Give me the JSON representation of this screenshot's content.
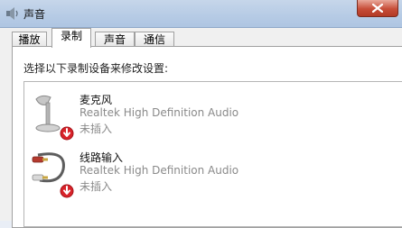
{
  "window": {
    "title": "声音",
    "icon": "speaker-icon",
    "close_icon": "close-icon"
  },
  "tabs": [
    {
      "label": "播放",
      "active": false
    },
    {
      "label": "录制",
      "active": true
    },
    {
      "label": "声音",
      "active": false
    },
    {
      "label": "通信",
      "active": false
    }
  ],
  "instruction": "选择以下录制设备来修改设置:",
  "devices": [
    {
      "name": "麦克风",
      "description": "Realtek High Definition Audio",
      "status": "未插入",
      "icon": "microphone-icon",
      "badge_icon": "unplugged-down-arrow-icon"
    },
    {
      "name": "线路输入",
      "description": "Realtek High Definition Audio",
      "status": "未插入",
      "icon": "line-in-cable-icon",
      "badge_icon": "unplugged-down-arrow-icon"
    }
  ],
  "colors": {
    "titlebar": "#b6cbe5",
    "close_button": "#c74d38",
    "badge_red": "#d8232a",
    "secondary_text": "#8a8a8a"
  }
}
